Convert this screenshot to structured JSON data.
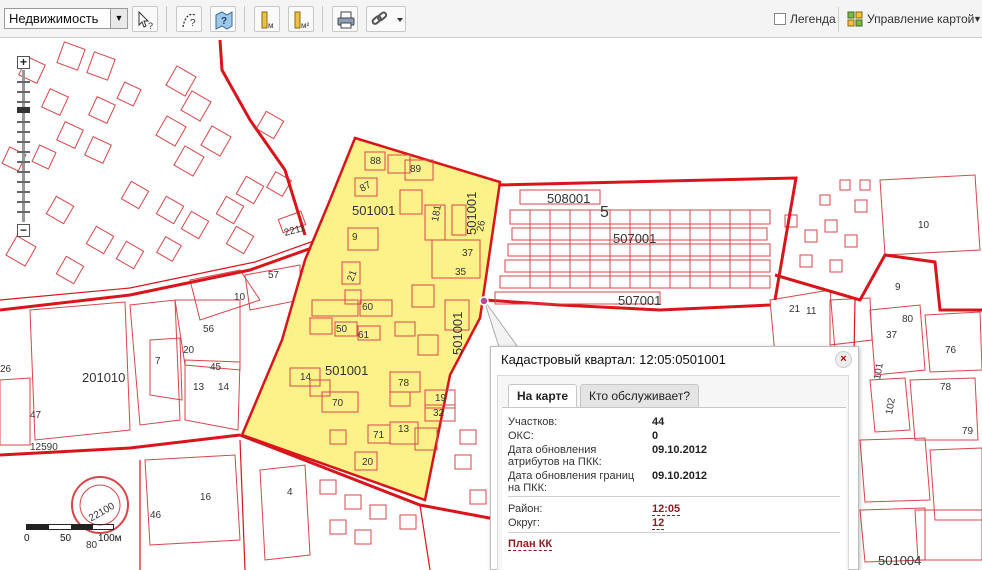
{
  "toolbar": {
    "layer_select": "Недвижимость",
    "legend_label": "Легенда",
    "map_control_label": "Управление картой"
  },
  "map": {
    "labels": [
      {
        "text": "501001",
        "key": "a"
      },
      {
        "text": "501001",
        "key": "b"
      },
      {
        "text": "501001",
        "key": "c"
      },
      {
        "text": "501001",
        "key": "d"
      },
      {
        "text": "508001",
        "key": "e"
      },
      {
        "text": "507001",
        "key": "f"
      },
      {
        "text": "507001",
        "key": "g"
      },
      {
        "text": "201010",
        "key": "h"
      },
      {
        "text": "501004",
        "key": "i"
      },
      {
        "text": "5",
        "key": "j"
      },
      {
        "text": "10",
        "key": "k"
      },
      {
        "text": "9",
        "key": "l"
      },
      {
        "text": "57",
        "key": "m"
      },
      {
        "text": "10",
        "key": "n"
      },
      {
        "text": "56",
        "key": "o"
      },
      {
        "text": "20",
        "key": "p"
      },
      {
        "text": "7",
        "key": "q"
      },
      {
        "text": "16",
        "key": "r"
      },
      {
        "text": "4",
        "key": "s"
      },
      {
        "text": "47",
        "key": "t"
      },
      {
        "text": "12590",
        "key": "u"
      },
      {
        "text": "22100",
        "key": "v"
      },
      {
        "text": "46",
        "key": "w"
      },
      {
        "text": "80",
        "key": "x"
      },
      {
        "text": "21",
        "key": "y"
      },
      {
        "text": "11",
        "key": "z"
      },
      {
        "text": "80",
        "key": "aa"
      },
      {
        "text": "37",
        "key": "ab"
      },
      {
        "text": "76",
        "key": "ac"
      },
      {
        "text": "78",
        "key": "ad"
      },
      {
        "text": "79",
        "key": "ae"
      },
      {
        "text": "102",
        "key": "af"
      },
      {
        "text": "101",
        "key": "ag"
      },
      {
        "text": "14",
        "key": "ah"
      },
      {
        "text": "70",
        "key": "ai"
      },
      {
        "text": "60",
        "key": "aj"
      },
      {
        "text": "61",
        "key": "ak"
      },
      {
        "text": "50",
        "key": "al"
      },
      {
        "text": "78",
        "key": "am"
      },
      {
        "text": "19",
        "key": "an"
      },
      {
        "text": "32",
        "key": "ao"
      },
      {
        "text": "71",
        "key": "ap"
      },
      {
        "text": "13",
        "key": "aq"
      },
      {
        "text": "20",
        "key": "ar"
      },
      {
        "text": "35",
        "key": "as"
      },
      {
        "text": "37",
        "key": "at"
      },
      {
        "text": "181",
        "key": "au"
      },
      {
        "text": "89",
        "key": "av"
      },
      {
        "text": "88",
        "key": "aw"
      },
      {
        "text": "87",
        "key": "ax"
      },
      {
        "text": "9",
        "key": "ay"
      },
      {
        "text": "26",
        "key": "az"
      },
      {
        "text": "45",
        "key": "ba"
      },
      {
        "text": "13",
        "key": "bb"
      },
      {
        "text": "14",
        "key": "bc"
      },
      {
        "text": "21",
        "key": "bd"
      },
      {
        "text": "26",
        "key": "be"
      },
      {
        "text": "2211",
        "key": "bf"
      }
    ],
    "scale": {
      "l0": "0",
      "l50": "50",
      "l100": "100м"
    }
  },
  "popup": {
    "title": "Кадастровый квартал: 12:05:0501001",
    "close": "×",
    "tabs": {
      "on_map": "На карте",
      "who_serves": "Кто обслуживает?"
    },
    "fields": {
      "plots_label": "Участков:",
      "plots_value": "44",
      "oks_label": "ОКС:",
      "oks_value": "0",
      "attr_update_label": "Дата обновления атрибутов на ПКК:",
      "attr_update_value": "09.10.2012",
      "bound_update_label": "Дата обновления границ на ПКК:",
      "bound_update_value": "09.10.2012",
      "district_label": "Район:",
      "district_value": "12:05",
      "okrug_label": "Округ:",
      "okrug_value": "12",
      "plan_link": "План КК"
    }
  },
  "colors": {
    "parcel_stroke": "#d8454a",
    "boundary": "#d9151c",
    "selected_fill": "#fdf28a",
    "link": "#8a1e1e"
  }
}
